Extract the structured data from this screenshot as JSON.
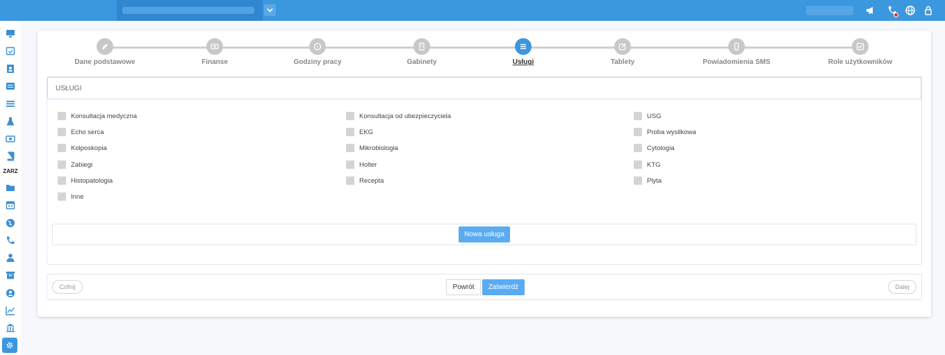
{
  "topbar": {
    "org_dropdown_icon": "chevron-down-icon",
    "icons": [
      "megaphone-icon",
      "phone-icon",
      "globe-icon",
      "lock-icon"
    ],
    "accent": "#3b97de"
  },
  "sidebar": {
    "section_label": "ZARZ",
    "icons": [
      "desktop-icon",
      "calendar-check-icon",
      "address-card-icon",
      "list-alt-icon",
      "bars-icon",
      "flask-icon",
      "money-icon",
      "book-icon",
      "folder-icon",
      "calendar-icon",
      "globe-icon",
      "phone-icon",
      "user-md-icon",
      "archive-icon",
      "user-circle-icon",
      "chart-line-icon",
      "bank-icon",
      "gear-icon"
    ]
  },
  "wizard": {
    "steps": [
      {
        "label": "Dane podstawowe",
        "icon": "pencil-icon"
      },
      {
        "label": "Finanse",
        "icon": "money-icon"
      },
      {
        "label": "Godziny pracy",
        "icon": "clock-icon"
      },
      {
        "label": "Gabinety",
        "icon": "building-icon"
      },
      {
        "label": "Usługi",
        "icon": "list-icon",
        "active": true
      },
      {
        "label": "Tablety",
        "icon": "edit-icon"
      },
      {
        "label": "Powiadomienia SMS",
        "icon": "mobile-icon"
      },
      {
        "label": "Role użytkowników",
        "icon": "check-square-icon"
      }
    ]
  },
  "services": {
    "title": "USŁUGI",
    "col1": [
      "Konsultacja medyczna",
      "Echo serca",
      "Kolposkopia",
      "Zabiegi",
      "Histopatologia",
      "Inne"
    ],
    "col2": [
      "Konsultacja od ubezpieczyciela",
      "EKG",
      "Mikrobiologia",
      "Holter",
      "Recepta"
    ],
    "col3": [
      "USG",
      "Proba wysilkowa",
      "Cytologia",
      "KTG",
      "Plyta"
    ],
    "new_button": "Nowa usługa"
  },
  "footer": {
    "back_label": "Cofnij",
    "return_label": "Powrót",
    "confirm_label": "Zatwierdź",
    "next_label": "Dalej"
  }
}
